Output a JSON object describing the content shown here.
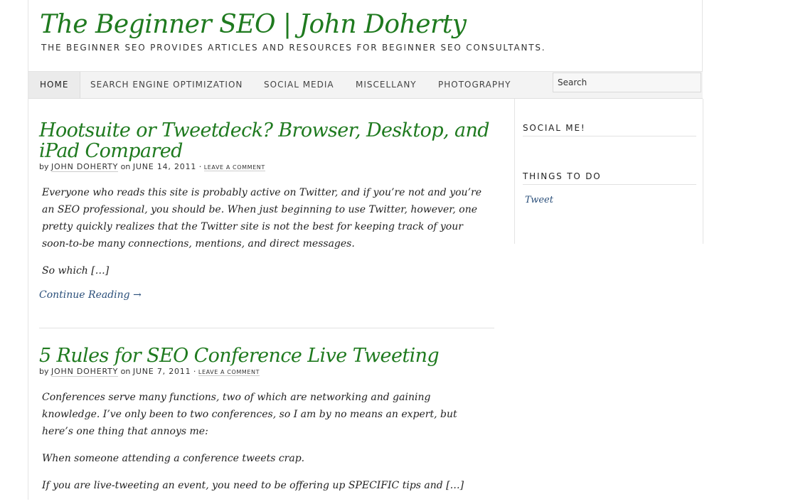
{
  "header": {
    "site_title": "The Beginner SEO | John Doherty",
    "tagline": "THE BEGINNER SEO PROVIDES ARTICLES AND RESOURCES FOR BEGINNER SEO CONSULTANTS."
  },
  "nav": {
    "items": [
      {
        "label": "HOME"
      },
      {
        "label": "SEARCH ENGINE OPTIMIZATION"
      },
      {
        "label": "SOCIAL MEDIA"
      },
      {
        "label": "MISCELLANY"
      },
      {
        "label": "PHOTOGRAPHY"
      }
    ],
    "search_value": "Search"
  },
  "posts": [
    {
      "title": "Hootsuite or Tweetdeck? Browser, Desktop, and iPad Compared",
      "by": "by",
      "author": "JOHN DOHERTY",
      "on": "on",
      "date": "JUNE 14, 2011",
      "sep": "·",
      "comment": "LEAVE A COMMENT",
      "paragraphs": [
        "Everyone who reads this site is probably active on Twitter, and if you’re not and you’re an SEO professional, you should be. When just beginning to use Twitter, however, one pretty quickly realizes that the Twitter site is not the best for keeping track of your soon-to-be many connections, mentions, and direct messages.",
        "So which […]"
      ],
      "continue": "Continue Reading →"
    },
    {
      "title": "5 Rules for SEO Conference Live Tweeting",
      "by": "by",
      "author": "JOHN DOHERTY",
      "on": "on",
      "date": "JUNE 7, 2011",
      "sep": "·",
      "comment": "LEAVE A COMMENT",
      "paragraphs": [
        "Conferences serve many functions, two of which are networking and gaining knowledge. I’ve only been to two conferences, so I am by no means an expert, but here’s one thing that annoys me:",
        "When someone attending a conference tweets crap.",
        "If you are live-tweeting an event, you need to be offering up SPECIFIC tips and […]"
      ]
    }
  ],
  "sidebar": {
    "widgets": [
      {
        "title": "SOCIAL ME!"
      },
      {
        "title": "THINGS TO DO"
      }
    ],
    "tweet_link": "Tweet"
  },
  "colors": {
    "title_green": "#1f7a1f",
    "link_blue": "#2a4f7a"
  }
}
